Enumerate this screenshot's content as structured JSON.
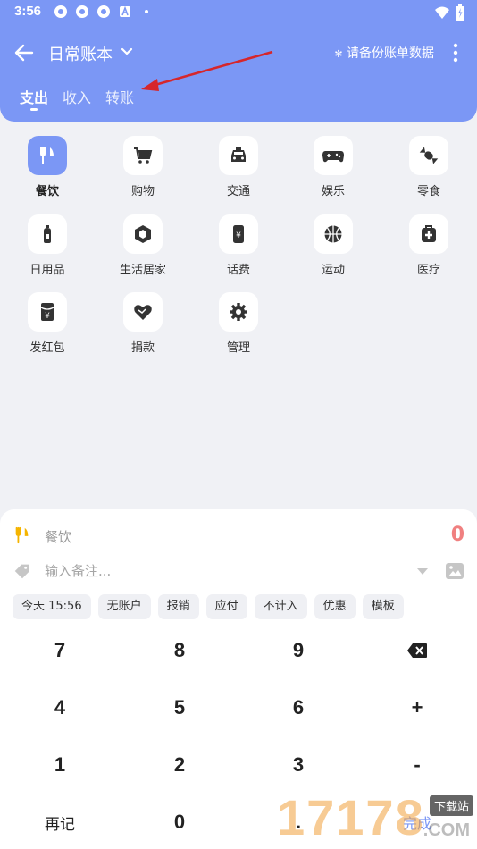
{
  "status": {
    "time": "3:56"
  },
  "header": {
    "title": "日常账本",
    "backup_text": "请备份账单数据",
    "tabs": [
      {
        "label": "支出",
        "active": true
      },
      {
        "label": "收入",
        "active": false
      },
      {
        "label": "转账",
        "active": false
      }
    ]
  },
  "categories": [
    {
      "label": "餐饮",
      "icon": "fork-knife-icon",
      "selected": true
    },
    {
      "label": "购物",
      "icon": "cart-icon",
      "selected": false
    },
    {
      "label": "交通",
      "icon": "car-icon",
      "selected": false
    },
    {
      "label": "娱乐",
      "icon": "gamepad-icon",
      "selected": false
    },
    {
      "label": "零食",
      "icon": "candy-icon",
      "selected": false
    },
    {
      "label": "日用品",
      "icon": "bottle-icon",
      "selected": false
    },
    {
      "label": "生活居家",
      "icon": "home-box-icon",
      "selected": false
    },
    {
      "label": "话费",
      "icon": "phone-icon",
      "selected": false
    },
    {
      "label": "运动",
      "icon": "basketball-icon",
      "selected": false
    },
    {
      "label": "医疗",
      "icon": "medical-kit-icon",
      "selected": false
    },
    {
      "label": "发红包",
      "icon": "red-packet-icon",
      "selected": false
    },
    {
      "label": "捐款",
      "icon": "donate-heart-icon",
      "selected": false
    },
    {
      "label": "管理",
      "icon": "gear-icon",
      "selected": false
    }
  ],
  "entry": {
    "category": "餐饮",
    "amount": "0",
    "note_placeholder": "输入备注..."
  },
  "chips": [
    "今天 15:56",
    "无账户",
    "报销",
    "应付",
    "不计入",
    "优惠",
    "模板"
  ],
  "keypad": [
    [
      "7",
      "8",
      "9",
      "⌫"
    ],
    [
      "4",
      "5",
      "6",
      "+"
    ],
    [
      "1",
      "2",
      "3",
      "-"
    ],
    [
      "再记",
      "0",
      ".",
      "完成"
    ]
  ],
  "watermark": {
    "number": "17178",
    "badge": "下载站",
    "domain": ".COM"
  },
  "colors": {
    "accent": "#7b97f5",
    "amount": "#f08080",
    "icon_yellow": "#f5b400"
  }
}
